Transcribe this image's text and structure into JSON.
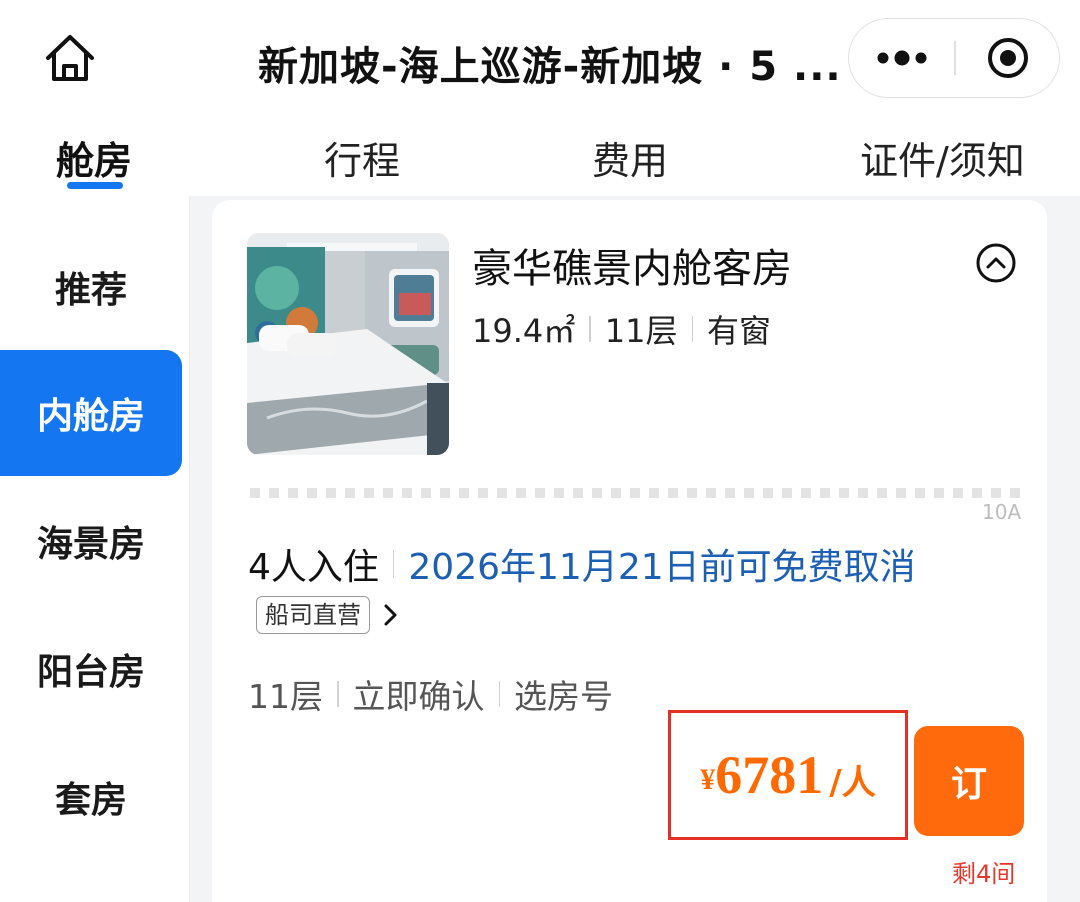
{
  "navbar": {
    "title": "新加坡-海上巡游-新加坡 · 5 ...",
    "home_icon": "home-icon",
    "more_icon": "more-dots-icon",
    "close_icon": "target-close-icon"
  },
  "tabs": [
    {
      "label": "舱房",
      "active": true
    },
    {
      "label": "行程",
      "active": false
    },
    {
      "label": "费用",
      "active": false
    },
    {
      "label": "证件/须知",
      "active": false
    }
  ],
  "sidebar": {
    "items": [
      {
        "label": "推荐",
        "active": false
      },
      {
        "label": "内舱房",
        "active": true
      },
      {
        "label": "海景房",
        "active": false
      },
      {
        "label": "阳台房",
        "active": false
      },
      {
        "label": "套房",
        "active": false
      }
    ]
  },
  "room": {
    "name": "豪华礁景内舱客房",
    "area": "19.4㎡",
    "floor": "11层",
    "window": "有窗",
    "code": "10A",
    "collapse_icon": "chevron-up-circle-icon"
  },
  "offer": {
    "guests": "4人入住",
    "cancel_policy": "2026年11月21日前可免费取消",
    "operator_tag": "船司直营",
    "features": [
      "11层",
      "立即确认",
      "选房号"
    ],
    "currency": "¥",
    "price": "6781",
    "price_unit": "/人",
    "book_label": "订",
    "remaining": "剩4间"
  },
  "colors": {
    "accent_blue": "#1476f0",
    "price_orange": "#ff6a00",
    "highlight_red": "#e53025",
    "link_blue": "#1c5fb3"
  }
}
